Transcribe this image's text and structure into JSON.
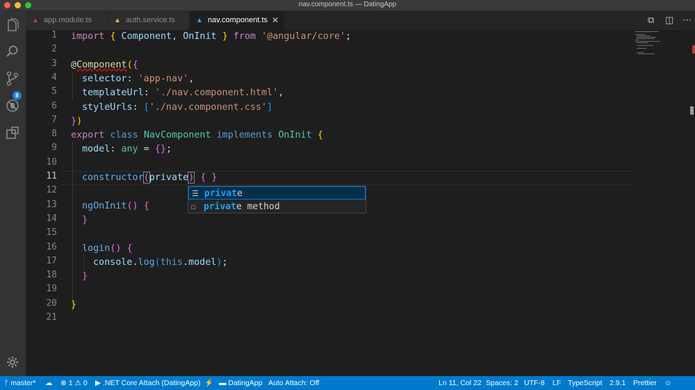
{
  "window": {
    "title": "nav.component.ts — DatingApp"
  },
  "tabs": [
    {
      "label": "app.module.ts",
      "icon": "angular-icon",
      "active": false
    },
    {
      "label": "auth.service.ts",
      "icon": "angular-icon",
      "active": false
    },
    {
      "label": "nav.component.ts",
      "icon": "typescript-icon",
      "active": true
    }
  ],
  "activity": {
    "scm_badge": "8"
  },
  "editor": {
    "line_numbers": [
      "1",
      "2",
      "3",
      "4",
      "5",
      "6",
      "7",
      "8",
      "9",
      "10",
      "11",
      "12",
      "13",
      "14",
      "15",
      "16",
      "17",
      "18",
      "19",
      "20",
      "21"
    ],
    "current_line": "11",
    "lines": {
      "l1": {
        "a": "import",
        "b": " ",
        "c": "{",
        "d": " Component, OnInit ",
        "e": "}",
        "f": " from ",
        "g": "'@angular/core'",
        "h": ";"
      },
      "l3": {
        "a": "@",
        "b": "Component",
        "c": "(",
        "d": "{"
      },
      "l4": {
        "a": "selector",
        "b": ": ",
        "c": "'app-nav'",
        "d": ","
      },
      "l5": {
        "a": "templateUrl",
        "b": ": ",
        "c": "'./nav.component.html'",
        "d": ","
      },
      "l6": {
        "a": "styleUrls",
        "b": ": ",
        "c": "[",
        "d": "'./nav.component.css'",
        "e": "]"
      },
      "l7": {
        "a": "}",
        "b": ")"
      },
      "l8": {
        "a": "export",
        "b": " ",
        "c": "class",
        "d": " ",
        "e": "NavComponent",
        "f": " ",
        "g": "implements",
        "h": " ",
        "i": "OnInit",
        "j": " ",
        "k": "{"
      },
      "l9": {
        "a": "model",
        "b": ": ",
        "c": "any",
        "d": " = ",
        "e": "{}",
        "f": ";"
      },
      "l11": {
        "a": "constructor",
        "b": "(",
        "c": "private",
        "d": ")",
        "e": " ",
        "f": "{ }"
      },
      "l13": {
        "a": "ngOnInit",
        "b": "()",
        "c": " ",
        "d": "{"
      },
      "l14": {
        "a": "}"
      },
      "l16": {
        "a": "login",
        "b": "()",
        "c": " ",
        "d": "{"
      },
      "l17": {
        "a": "console",
        "b": ".",
        "c": "log",
        "d": "(",
        "e": "this",
        "f": ".",
        "g": "model",
        "h": ")",
        "i": ";"
      },
      "l18": {
        "a": "}"
      },
      "l20": {
        "a": "}"
      }
    }
  },
  "suggestions": [
    {
      "match": "privat",
      "rest": "e",
      "icon": "keyword-icon"
    },
    {
      "match": "privat",
      "rest": "e method",
      "icon": "snippet-icon"
    }
  ],
  "statusbar": {
    "branch": "master*",
    "errors": "1",
    "warnings": "0",
    "debug": ".NET Core Attach (DatingApp)",
    "folder": "DatingApp",
    "auto_attach": "Auto Attach: Off",
    "position": "Ln 11, Col 22",
    "spaces": "Spaces: 2",
    "encoding": "UTF-8",
    "eol": "LF",
    "language": "TypeScript",
    "version": "2.9.1",
    "formatter": "Prettier"
  },
  "colors": {
    "accent": "#007acc",
    "background": "#1e1e1e",
    "activity_bar": "#333333"
  }
}
